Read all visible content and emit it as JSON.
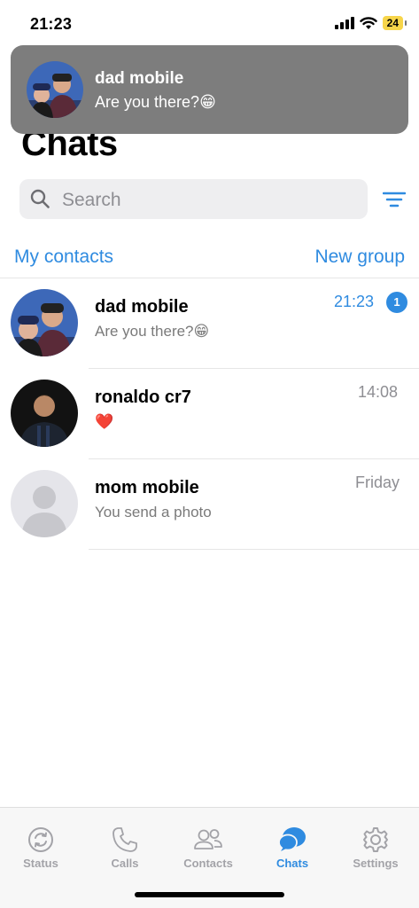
{
  "status_bar": {
    "time": "21:23",
    "battery": "24"
  },
  "notification": {
    "name": "dad mobile",
    "message": "Are you there?😁"
  },
  "header": {
    "title": "Chats"
  },
  "search": {
    "placeholder": "Search"
  },
  "links": {
    "left": "My contacts",
    "right": "New group"
  },
  "chats": [
    {
      "name": "dad mobile",
      "preview": "Are you there?😁",
      "time": "21:23",
      "unread": "1"
    },
    {
      "name": "ronaldo cr7",
      "preview": "❤️",
      "time": "14:08"
    },
    {
      "name": "mom mobile",
      "preview": "You send a photo",
      "time": "Friday"
    }
  ],
  "tabs": [
    {
      "label": "Status",
      "icon": "status-icon"
    },
    {
      "label": "Calls",
      "icon": "phone-icon"
    },
    {
      "label": "Contacts",
      "icon": "contacts-icon"
    },
    {
      "label": "Chats",
      "icon": "chat-bubbles-icon",
      "active": true
    },
    {
      "label": "Settings",
      "icon": "gear-icon"
    }
  ],
  "colors": {
    "accent": "#2f8be0",
    "banner": "#7d7d7d",
    "inactive_tab": "#a3a3a8",
    "battery": "#f7d54a"
  }
}
